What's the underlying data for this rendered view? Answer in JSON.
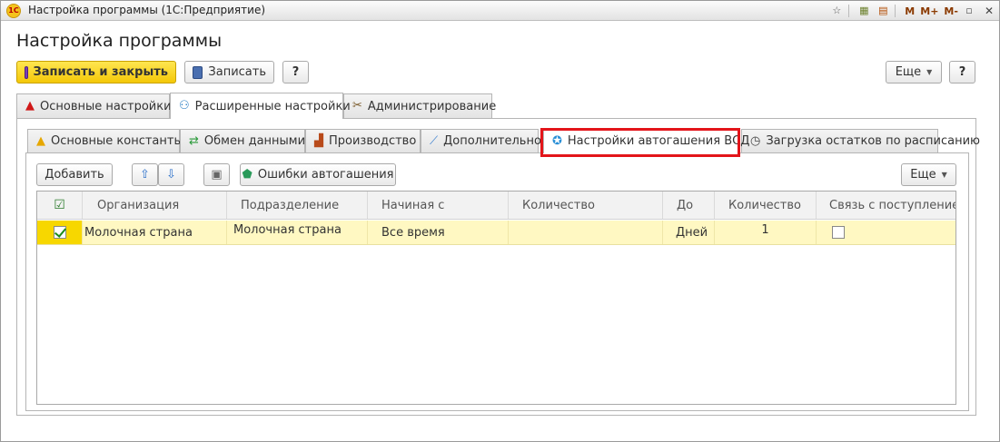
{
  "window": {
    "title": "Настройка программы  (1С:Предприятие)",
    "toolbar_m": "M",
    "toolbar_m_plus": "M+",
    "toolbar_m_minus": "M-"
  },
  "page": {
    "title": "Настройка программы"
  },
  "commands": {
    "save_and_close": "Записать и закрыть",
    "save": "Записать",
    "help": "?",
    "more": "Еще"
  },
  "main_tabs": [
    {
      "label": "Основные настройки",
      "icon": "warning-icon"
    },
    {
      "label": "Расширенные настройки",
      "icon": "network-icon"
    },
    {
      "label": "Администрирование",
      "icon": "tools-icon"
    }
  ],
  "sub_tabs": [
    {
      "label": "Основные константы",
      "icon": "warning-icon"
    },
    {
      "label": "Обмен данными",
      "icon": "exchange-icon"
    },
    {
      "label": "Производство",
      "icon": "factory-icon"
    },
    {
      "label": "Дополнительно",
      "icon": "syringe-icon"
    },
    {
      "label": "Настройки автогашения ВСД",
      "icon": "badge-icon"
    },
    {
      "label": "Загрузка остатков по расписанию",
      "icon": "clock-icon"
    }
  ],
  "table_toolbar": {
    "add": "Добавить",
    "errors": "Ошибки автогашения",
    "more": "Еще"
  },
  "table": {
    "columns": [
      "Организация",
      "Подразделение",
      "Начиная с",
      "Количество",
      "До",
      "Количество",
      "Связь с поступлением"
    ],
    "rows": [
      {
        "enabled": true,
        "organization": "Молочная страна",
        "department": "Молочная страна",
        "starting_from": "Все время",
        "quantity_from": "",
        "until": "Дней",
        "quantity_until": "1",
        "link_to_receipt": false
      }
    ]
  },
  "colors": {
    "accent_yellow": "#f4c808",
    "highlight_red": "#e3151a",
    "row_selected": "#fff8c2"
  }
}
